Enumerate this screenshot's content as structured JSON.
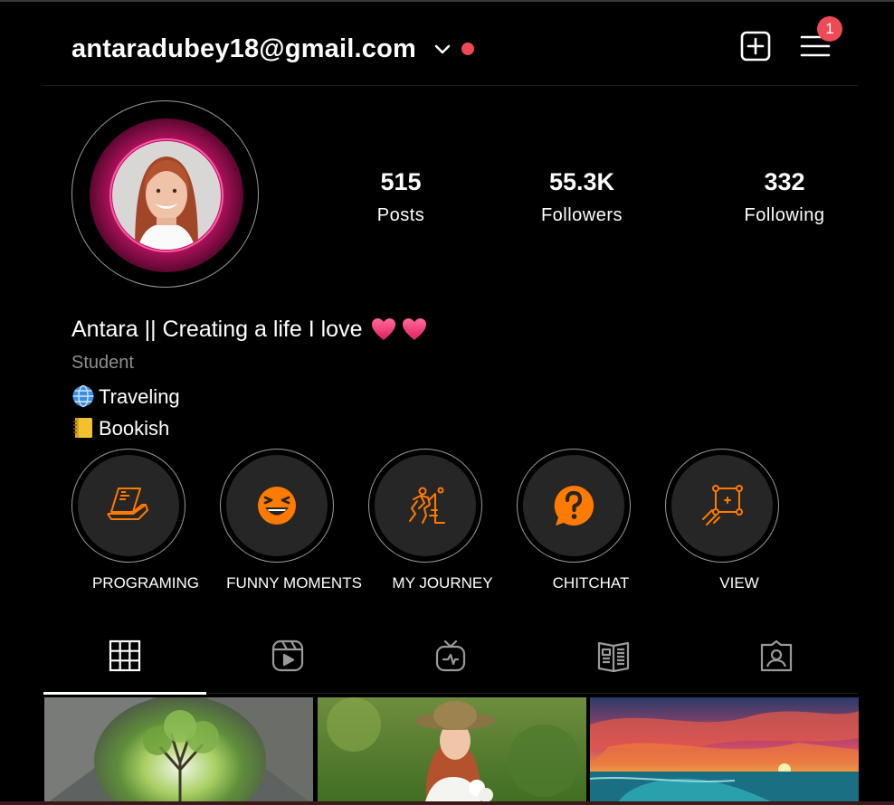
{
  "header": {
    "username": "antaradubey18@gmail.com",
    "notification_count": "1",
    "colors": {
      "accent": "#ed4956",
      "background": "#000000"
    }
  },
  "stats": {
    "posts": {
      "value": "515",
      "label": "Posts"
    },
    "followers": {
      "value": "55.3K",
      "label": "Followers"
    },
    "following": {
      "value": "332",
      "label": "Following"
    }
  },
  "bio": {
    "name": "Antara || Creating a life I love",
    "category": "Student",
    "lines": [
      {
        "icon": "globe-icon",
        "text": "Traveling"
      },
      {
        "icon": "notebook-icon",
        "text": "Bookish"
      }
    ]
  },
  "highlights": [
    {
      "label": "PROGRAMING",
      "icon": "laptop-icon"
    },
    {
      "label": "FUNNY MOMENTS",
      "icon": "laughing-face-icon"
    },
    {
      "label": "MY JOURNEY",
      "icon": "climber-icon"
    },
    {
      "label": "CHITCHAT",
      "icon": "question-bubble-icon"
    },
    {
      "label": "VIEW",
      "icon": "frame-icon"
    }
  ],
  "tabs": [
    {
      "name": "posts",
      "icon": "grid-icon",
      "active": true
    },
    {
      "name": "reels",
      "icon": "reels-icon",
      "active": false
    },
    {
      "name": "igtv",
      "icon": "tv-icon",
      "active": false
    },
    {
      "name": "guides",
      "icon": "guides-icon",
      "active": false
    },
    {
      "name": "tagged",
      "icon": "tagged-icon",
      "active": false
    }
  ],
  "icon_color": "#ff7a00"
}
